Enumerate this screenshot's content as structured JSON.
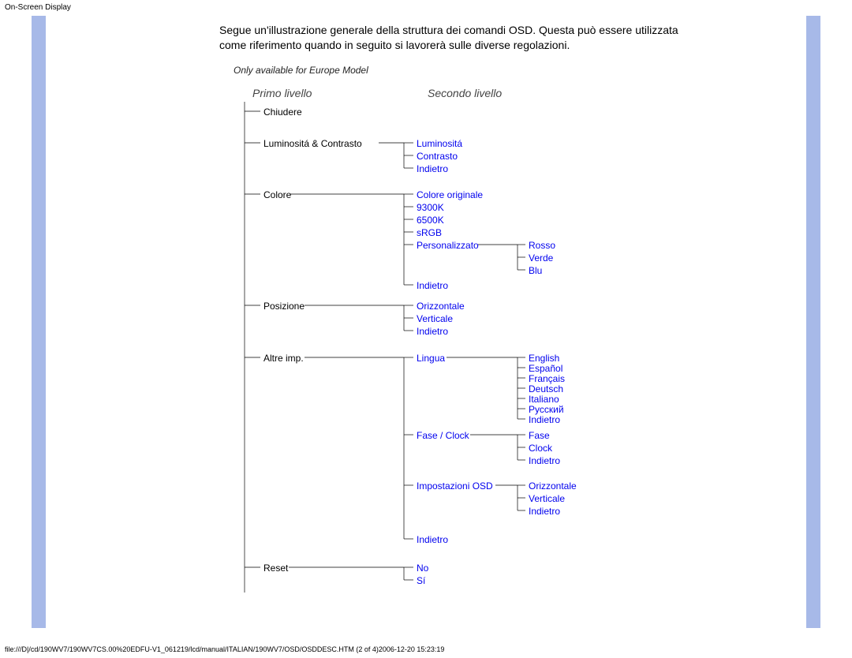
{
  "header": {
    "title": "On-Screen Display"
  },
  "intro": "Segue un'illustrazione generale della struttura dei comandi OSD. Questa può essere utilizzata come riferimento quando in seguito si lavorerà sulle diverse regolazioni.",
  "diagram": {
    "title": "Only available for Europe Model",
    "level1_hdr": "Primo livello",
    "level2_hdr": "Secondo livello",
    "level1": {
      "chiudere": "Chiudere",
      "lumcon": "Luminositá & Contrasto",
      "colore": "Colore",
      "posizione": "Posizione",
      "altre": "Altre imp.",
      "reset": "Reset"
    },
    "level2": {
      "luminosita": "Luminositá",
      "contrasto": "Contrasto",
      "indietro1": "Indietro",
      "colore_orig": "Colore originale",
      "k9300": "9300K",
      "k6500": "6500K",
      "srgb": "sRGB",
      "personalizzato": "Personalizzato",
      "indietro2": "Indietro",
      "orizzontale": "Orizzontale",
      "verticale": "Verticale",
      "indietro3": "Indietro",
      "lingua": "Lingua",
      "faseclock": "Fase / Clock",
      "imposd": "Impostazioni OSD",
      "indietro4": "Indietro",
      "no": "No",
      "si": "Sí"
    },
    "level3": {
      "rosso": "Rosso",
      "verde": "Verde",
      "blu": "Blu",
      "english": "English",
      "espanol": "Español",
      "francais": "Français",
      "deutsch": "Deutsch",
      "italiano": "Italiano",
      "russkiy": "Русский",
      "indietro_l": "Indietro",
      "fase": "Fase",
      "clock": "Clock",
      "indietro_f": "Indietro",
      "orizz_osd": "Orizzontale",
      "vert_osd": "Verticale",
      "indietro_o": "Indietro"
    }
  },
  "footer": "file:///D|/cd/190WV7/190WV7CS.00%20EDFU-V1_061219/lcd/manual/ITALIAN/190WV7/OSD/OSDDESC.HTM (2 of 4)2006-12-20 15:23:19"
}
